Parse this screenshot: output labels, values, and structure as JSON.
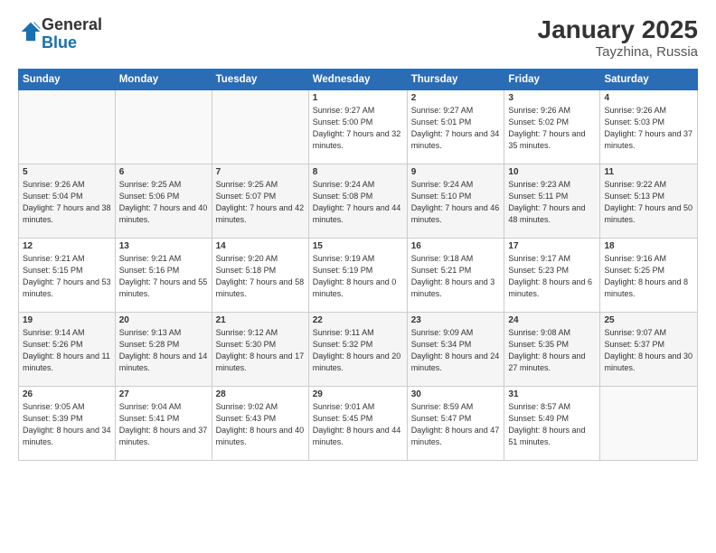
{
  "logo": {
    "general": "General",
    "blue": "Blue"
  },
  "title": "January 2025",
  "subtitle": "Tayzhina, Russia",
  "weekdays": [
    "Sunday",
    "Monday",
    "Tuesday",
    "Wednesday",
    "Thursday",
    "Friday",
    "Saturday"
  ],
  "weeks": [
    [
      {
        "day": "",
        "sunrise": "",
        "sunset": "",
        "daylight": ""
      },
      {
        "day": "",
        "sunrise": "",
        "sunset": "",
        "daylight": ""
      },
      {
        "day": "",
        "sunrise": "",
        "sunset": "",
        "daylight": ""
      },
      {
        "day": "1",
        "sunrise": "Sunrise: 9:27 AM",
        "sunset": "Sunset: 5:00 PM",
        "daylight": "Daylight: 7 hours and 32 minutes."
      },
      {
        "day": "2",
        "sunrise": "Sunrise: 9:27 AM",
        "sunset": "Sunset: 5:01 PM",
        "daylight": "Daylight: 7 hours and 34 minutes."
      },
      {
        "day": "3",
        "sunrise": "Sunrise: 9:26 AM",
        "sunset": "Sunset: 5:02 PM",
        "daylight": "Daylight: 7 hours and 35 minutes."
      },
      {
        "day": "4",
        "sunrise": "Sunrise: 9:26 AM",
        "sunset": "Sunset: 5:03 PM",
        "daylight": "Daylight: 7 hours and 37 minutes."
      }
    ],
    [
      {
        "day": "5",
        "sunrise": "Sunrise: 9:26 AM",
        "sunset": "Sunset: 5:04 PM",
        "daylight": "Daylight: 7 hours and 38 minutes."
      },
      {
        "day": "6",
        "sunrise": "Sunrise: 9:25 AM",
        "sunset": "Sunset: 5:06 PM",
        "daylight": "Daylight: 7 hours and 40 minutes."
      },
      {
        "day": "7",
        "sunrise": "Sunrise: 9:25 AM",
        "sunset": "Sunset: 5:07 PM",
        "daylight": "Daylight: 7 hours and 42 minutes."
      },
      {
        "day": "8",
        "sunrise": "Sunrise: 9:24 AM",
        "sunset": "Sunset: 5:08 PM",
        "daylight": "Daylight: 7 hours and 44 minutes."
      },
      {
        "day": "9",
        "sunrise": "Sunrise: 9:24 AM",
        "sunset": "Sunset: 5:10 PM",
        "daylight": "Daylight: 7 hours and 46 minutes."
      },
      {
        "day": "10",
        "sunrise": "Sunrise: 9:23 AM",
        "sunset": "Sunset: 5:11 PM",
        "daylight": "Daylight: 7 hours and 48 minutes."
      },
      {
        "day": "11",
        "sunrise": "Sunrise: 9:22 AM",
        "sunset": "Sunset: 5:13 PM",
        "daylight": "Daylight: 7 hours and 50 minutes."
      }
    ],
    [
      {
        "day": "12",
        "sunrise": "Sunrise: 9:21 AM",
        "sunset": "Sunset: 5:15 PM",
        "daylight": "Daylight: 7 hours and 53 minutes."
      },
      {
        "day": "13",
        "sunrise": "Sunrise: 9:21 AM",
        "sunset": "Sunset: 5:16 PM",
        "daylight": "Daylight: 7 hours and 55 minutes."
      },
      {
        "day": "14",
        "sunrise": "Sunrise: 9:20 AM",
        "sunset": "Sunset: 5:18 PM",
        "daylight": "Daylight: 7 hours and 58 minutes."
      },
      {
        "day": "15",
        "sunrise": "Sunrise: 9:19 AM",
        "sunset": "Sunset: 5:19 PM",
        "daylight": "Daylight: 8 hours and 0 minutes."
      },
      {
        "day": "16",
        "sunrise": "Sunrise: 9:18 AM",
        "sunset": "Sunset: 5:21 PM",
        "daylight": "Daylight: 8 hours and 3 minutes."
      },
      {
        "day": "17",
        "sunrise": "Sunrise: 9:17 AM",
        "sunset": "Sunset: 5:23 PM",
        "daylight": "Daylight: 8 hours and 6 minutes."
      },
      {
        "day": "18",
        "sunrise": "Sunrise: 9:16 AM",
        "sunset": "Sunset: 5:25 PM",
        "daylight": "Daylight: 8 hours and 8 minutes."
      }
    ],
    [
      {
        "day": "19",
        "sunrise": "Sunrise: 9:14 AM",
        "sunset": "Sunset: 5:26 PM",
        "daylight": "Daylight: 8 hours and 11 minutes."
      },
      {
        "day": "20",
        "sunrise": "Sunrise: 9:13 AM",
        "sunset": "Sunset: 5:28 PM",
        "daylight": "Daylight: 8 hours and 14 minutes."
      },
      {
        "day": "21",
        "sunrise": "Sunrise: 9:12 AM",
        "sunset": "Sunset: 5:30 PM",
        "daylight": "Daylight: 8 hours and 17 minutes."
      },
      {
        "day": "22",
        "sunrise": "Sunrise: 9:11 AM",
        "sunset": "Sunset: 5:32 PM",
        "daylight": "Daylight: 8 hours and 20 minutes."
      },
      {
        "day": "23",
        "sunrise": "Sunrise: 9:09 AM",
        "sunset": "Sunset: 5:34 PM",
        "daylight": "Daylight: 8 hours and 24 minutes."
      },
      {
        "day": "24",
        "sunrise": "Sunrise: 9:08 AM",
        "sunset": "Sunset: 5:35 PM",
        "daylight": "Daylight: 8 hours and 27 minutes."
      },
      {
        "day": "25",
        "sunrise": "Sunrise: 9:07 AM",
        "sunset": "Sunset: 5:37 PM",
        "daylight": "Daylight: 8 hours and 30 minutes."
      }
    ],
    [
      {
        "day": "26",
        "sunrise": "Sunrise: 9:05 AM",
        "sunset": "Sunset: 5:39 PM",
        "daylight": "Daylight: 8 hours and 34 minutes."
      },
      {
        "day": "27",
        "sunrise": "Sunrise: 9:04 AM",
        "sunset": "Sunset: 5:41 PM",
        "daylight": "Daylight: 8 hours and 37 minutes."
      },
      {
        "day": "28",
        "sunrise": "Sunrise: 9:02 AM",
        "sunset": "Sunset: 5:43 PM",
        "daylight": "Daylight: 8 hours and 40 minutes."
      },
      {
        "day": "29",
        "sunrise": "Sunrise: 9:01 AM",
        "sunset": "Sunset: 5:45 PM",
        "daylight": "Daylight: 8 hours and 44 minutes."
      },
      {
        "day": "30",
        "sunrise": "Sunrise: 8:59 AM",
        "sunset": "Sunset: 5:47 PM",
        "daylight": "Daylight: 8 hours and 47 minutes."
      },
      {
        "day": "31",
        "sunrise": "Sunrise: 8:57 AM",
        "sunset": "Sunset: 5:49 PM",
        "daylight": "Daylight: 8 hours and 51 minutes."
      },
      {
        "day": "",
        "sunrise": "",
        "sunset": "",
        "daylight": ""
      }
    ]
  ]
}
